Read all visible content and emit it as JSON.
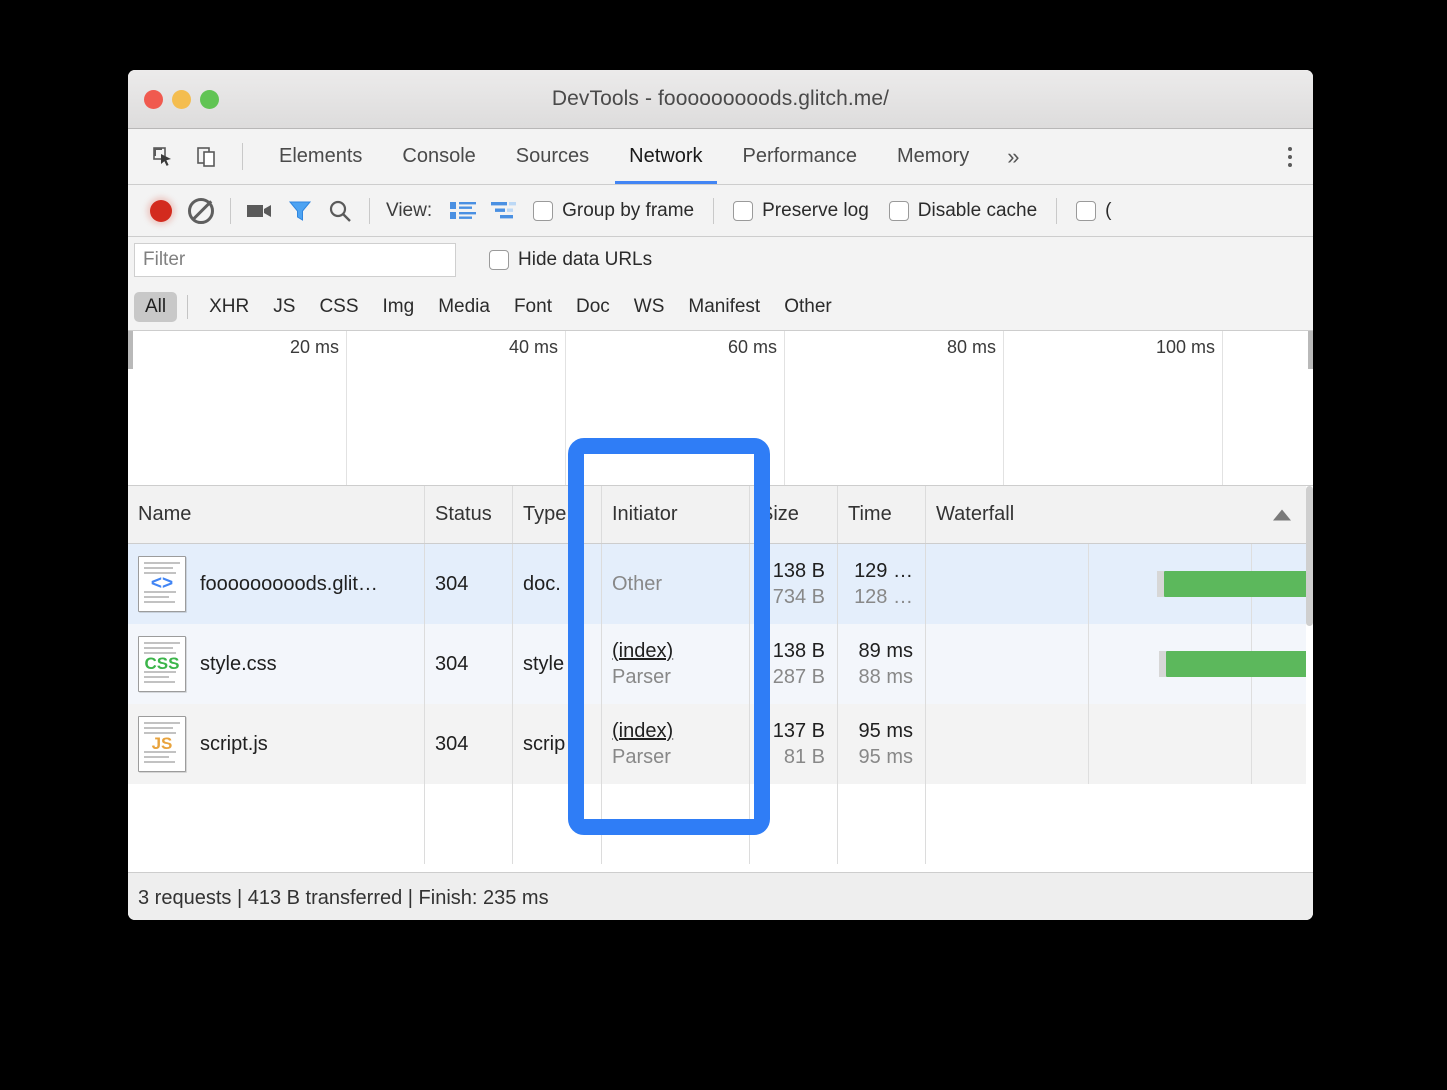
{
  "window": {
    "title": "DevTools - fooooooooods.glitch.me/",
    "traffic_lights": [
      "close",
      "minimize",
      "maximize"
    ]
  },
  "tabbar": {
    "inspect_icon": "inspect-element-icon",
    "device_icon": "device-toolbar-icon",
    "tabs": [
      {
        "label": "Elements",
        "active": false
      },
      {
        "label": "Console",
        "active": false
      },
      {
        "label": "Sources",
        "active": false
      },
      {
        "label": "Network",
        "active": true
      },
      {
        "label": "Performance",
        "active": false
      },
      {
        "label": "Memory",
        "active": false
      }
    ],
    "more_tabs_label": "»",
    "menu_icon": "kebab-menu-icon",
    "accent_color": "#4285f4"
  },
  "network_toolbar": {
    "record_icon": "record-button-icon",
    "record_color": "#d32b1e",
    "clear_icon": "clear-icon",
    "capture_screenshots_icon": "camera-icon",
    "filter_icon": "filter-funnel-icon",
    "search_icon": "search-icon",
    "view_label": "View:",
    "view_large_rows_icon": "large-request-rows-icon",
    "view_waterfall_icon": "show-overview-icon",
    "checkboxes": [
      {
        "label": "Group by frame",
        "checked": false
      },
      {
        "label": "Preserve log",
        "checked": false
      },
      {
        "label": "Disable cache",
        "checked": false
      },
      {
        "label": "(",
        "checked": false
      }
    ]
  },
  "filter_row": {
    "placeholder": "Filter",
    "value": "",
    "hide_data_urls_label": "Hide data URLs",
    "hide_data_urls_checked": false
  },
  "type_filters": {
    "all": "All",
    "items": [
      "XHR",
      "JS",
      "CSS",
      "Img",
      "Media",
      "Font",
      "Doc",
      "WS",
      "Manifest",
      "Other"
    ]
  },
  "overview": {
    "ticks": [
      "20 ms",
      "40 ms",
      "60 ms",
      "80 ms",
      "100 ms"
    ]
  },
  "table": {
    "columns": [
      "Name",
      "Status",
      "Type",
      "Initiator",
      "Size",
      "Time",
      "Waterfall"
    ],
    "sort_column": "Waterfall",
    "sort_direction": "ascending",
    "rows": [
      {
        "icon": "html-file-icon",
        "icon_glyph": "<>",
        "name": "fooooooooods.glit…",
        "status": "304",
        "type": "doc.",
        "initiator_primary": "Other",
        "initiator_secondary": "",
        "size_primary": "138 B",
        "size_secondary": "734 B",
        "time_primary": "129 …",
        "time_secondary": "128 …",
        "selected": true
      },
      {
        "icon": "css-file-icon",
        "icon_glyph": "CSS",
        "name": "style.css",
        "status": "304",
        "type": "style",
        "initiator_primary": "(index)",
        "initiator_secondary": "Parser",
        "size_primary": "138 B",
        "size_secondary": "287 B",
        "time_primary": "89 ms",
        "time_secondary": "88 ms",
        "selected": false
      },
      {
        "icon": "js-file-icon",
        "icon_glyph": "JS",
        "name": "script.js",
        "status": "304",
        "type": "scrip",
        "initiator_primary": "(index)",
        "initiator_secondary": "Parser",
        "size_primary": "137 B",
        "size_secondary": "81 B",
        "time_primary": "95 ms",
        "time_secondary": "95 ms",
        "selected": false
      }
    ],
    "waterfall_bar_color": "#5cb85c"
  },
  "status_bar": {
    "text": "3 requests | 413 B transferred | Finish: 235 ms"
  },
  "callout": {
    "name": "initiator-column-highlight",
    "color": "#2f7df6"
  }
}
